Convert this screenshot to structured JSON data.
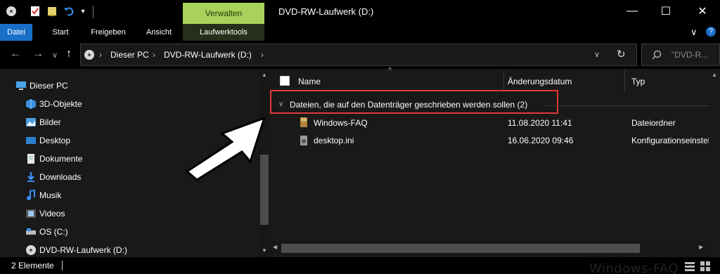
{
  "titlebar": {
    "context_tab": "Verwalten",
    "title": "DVD-RW-Laufwerk (D:)",
    "minimize": "—",
    "maximize": "☐",
    "close": "✕"
  },
  "ribbon": {
    "tabs": [
      {
        "label": "Datei"
      },
      {
        "label": "Start"
      },
      {
        "label": "Freigeben"
      },
      {
        "label": "Ansicht"
      },
      {
        "label": "Laufwerktools"
      }
    ],
    "collapse_glyph": "∨",
    "help_glyph": "?"
  },
  "address": {
    "back": "←",
    "forward": "→",
    "recent": "∨",
    "up": "↑",
    "crumbs": [
      "Dieser PC",
      "DVD-RW-Laufwerk (D:)"
    ],
    "crumb_sep": "›",
    "dropdown": "∨",
    "refresh": "↻",
    "search_placeholder": "\"DVD-R..."
  },
  "navpane": {
    "items": [
      {
        "label": "Dieser PC",
        "icon": "computer-icon"
      },
      {
        "label": "3D-Objekte",
        "icon": "3d-objects-icon"
      },
      {
        "label": "Bilder",
        "icon": "pictures-icon"
      },
      {
        "label": "Desktop",
        "icon": "desktop-icon"
      },
      {
        "label": "Dokumente",
        "icon": "documents-icon"
      },
      {
        "label": "Downloads",
        "icon": "downloads-icon"
      },
      {
        "label": "Musik",
        "icon": "music-icon"
      },
      {
        "label": "Videos",
        "icon": "videos-icon"
      },
      {
        "label": "OS (C:)",
        "icon": "drive-icon"
      },
      {
        "label": "DVD-RW-Laufwerk (D:)",
        "icon": "dvd-drive-icon"
      }
    ]
  },
  "filelist": {
    "columns": [
      "Name",
      "Änderungsdatum",
      "Typ"
    ],
    "sort_glyph": "^",
    "group": {
      "label": "Dateien, die auf den Datenträger geschrieben werden sollen (2)",
      "chevron": "∨"
    },
    "rows": [
      {
        "name": "Windows-FAQ",
        "date": "11.08.2020 11:41",
        "type": "Dateiordner",
        "icon": "folder-icon"
      },
      {
        "name": "desktop.ini",
        "date": "16.06.2020 09:46",
        "type": "Konfigurationseinstell...",
        "icon": "settings-file-icon"
      }
    ]
  },
  "status": {
    "count": "2 Elemente"
  },
  "watermark": "Windows-FAQ",
  "colors": {
    "accent": "#1a6fc9",
    "context_tab": "#a9d25b",
    "highlight_box": "#e03a3a",
    "background": "#191919"
  }
}
